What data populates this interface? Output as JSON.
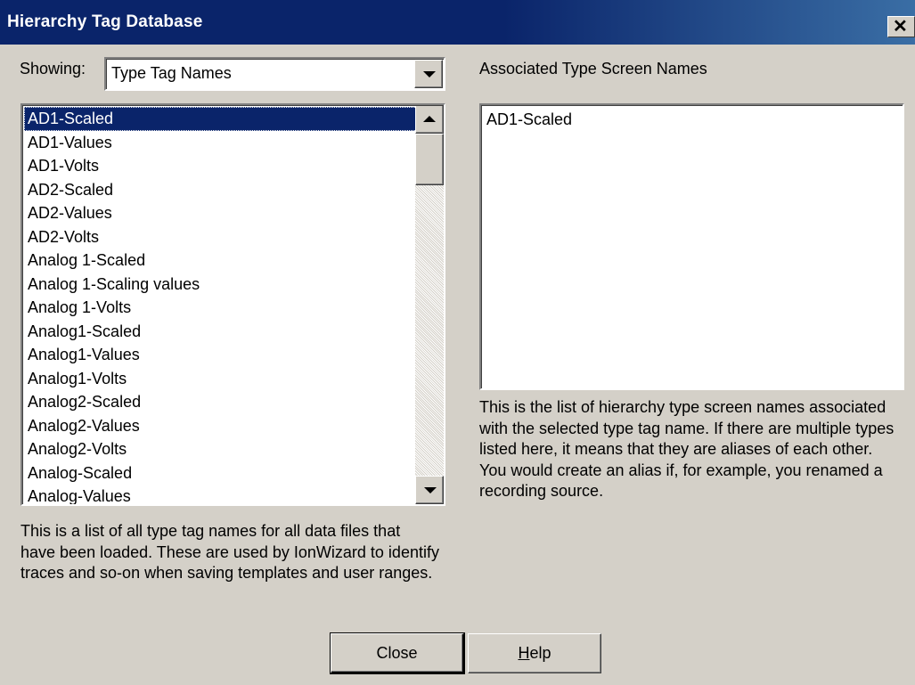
{
  "window": {
    "title": "Hierarchy Tag Database"
  },
  "showing": {
    "label": "Showing:",
    "value": "Type Tag Names"
  },
  "type_list": {
    "items": [
      "AD1-Scaled",
      "AD1-Values",
      "AD1-Volts",
      "AD2-Scaled",
      "AD2-Values",
      "AD2-Volts",
      "Analog 1-Scaled",
      "Analog 1-Scaling values",
      "Analog 1-Volts",
      "Analog1-Scaled",
      "Analog1-Values",
      "Analog1-Volts",
      "Analog2-Scaled",
      "Analog2-Values",
      "Analog2-Volts",
      "Analog-Scaled",
      "Analog-Values"
    ],
    "selected_index": 0,
    "description": "This is a list of all type tag names for all data files that have been loaded.  These are used by IonWizard to identify traces and so-on when saving templates and user ranges."
  },
  "screen_names": {
    "label": "Associated Type Screen Names",
    "items": [
      "AD1-Scaled"
    ],
    "description": "This is the list of hierarchy type screen names associated with the selected type tag name.  If there are multiple types listed here, it means that they are aliases of each other.  You would create an alias if, for example, you renamed a recording source."
  },
  "buttons": {
    "close": "Close",
    "help_mnemonic": "H",
    "help_rest": "elp"
  },
  "icons": {
    "close": "close-icon",
    "dropdown": "chevron-down-icon",
    "scroll_up": "arrow-up-icon",
    "scroll_down": "arrow-down-icon"
  }
}
